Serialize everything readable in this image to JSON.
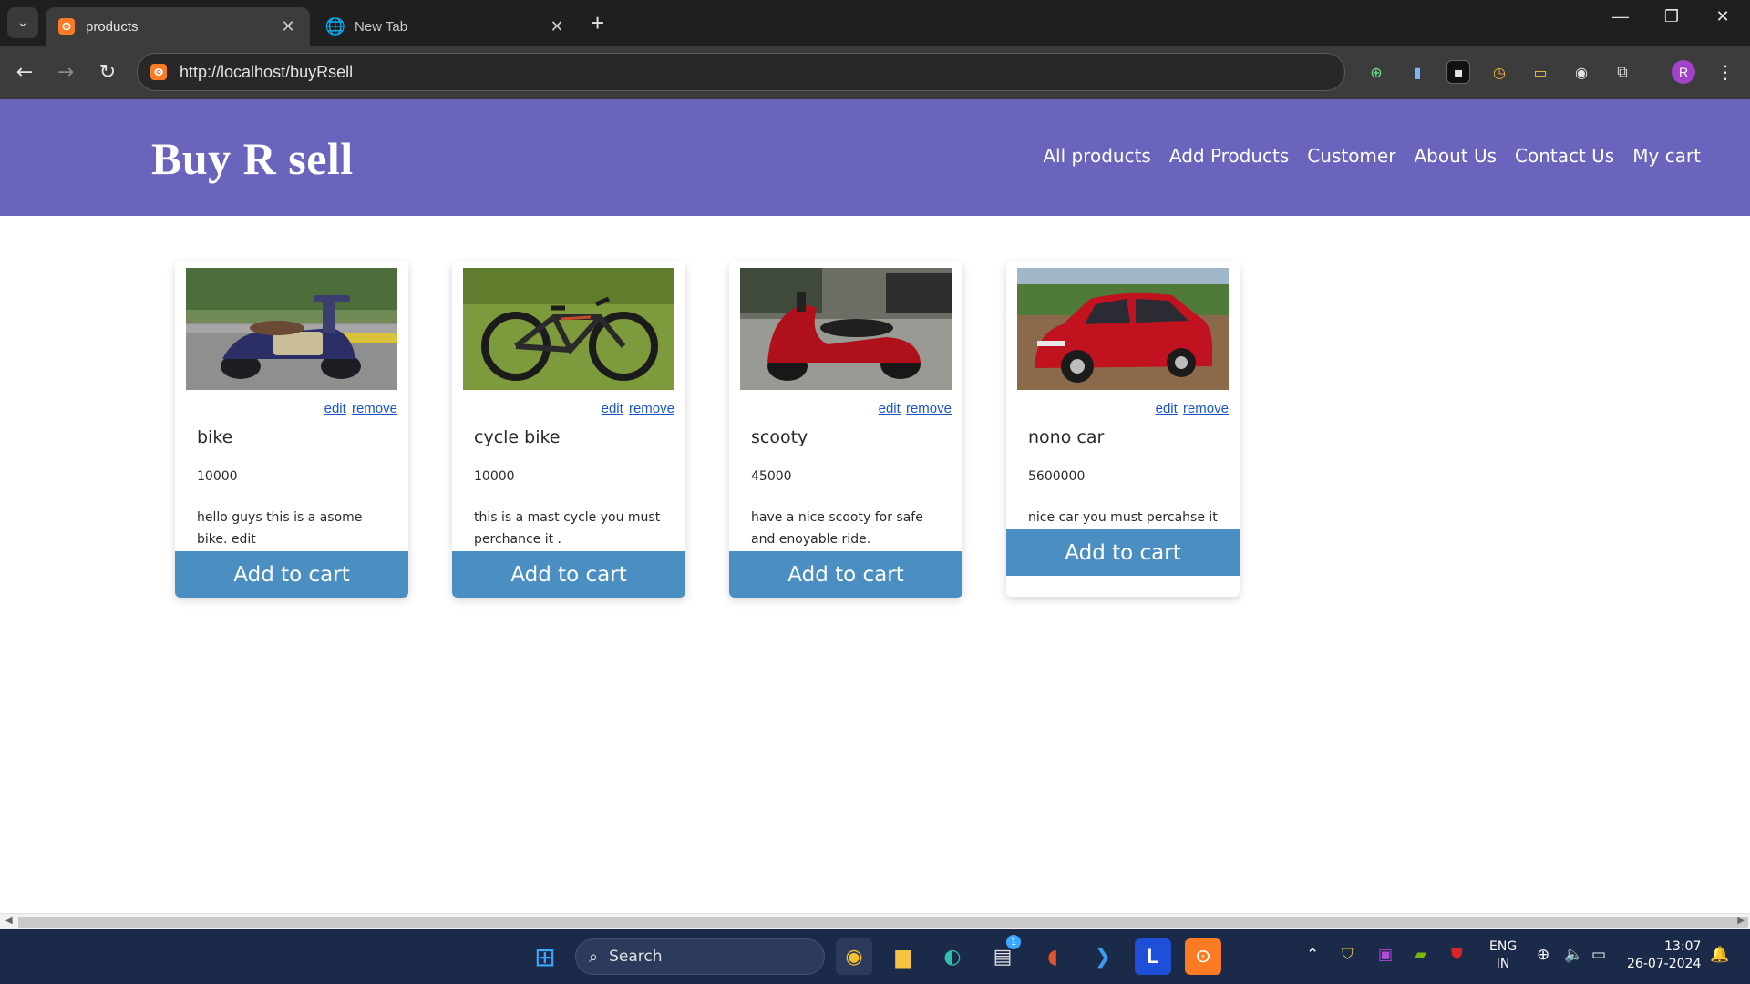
{
  "browser": {
    "tabs": [
      {
        "title": "products",
        "active": true
      },
      {
        "title": "New Tab",
        "active": false
      }
    ],
    "url": "http://localhost/buyRsell",
    "profile_initial": "R"
  },
  "site": {
    "brand": "Buy R sell",
    "nav": [
      "All products",
      "Add Products",
      "Customer",
      "About Us",
      "Contact Us",
      "My cart"
    ]
  },
  "products": [
    {
      "name": "bike",
      "price": "10000",
      "description": "hello guys this is a asome bike. edit",
      "edit_label": "edit",
      "remove_label": "remove",
      "cta": "Add to cart"
    },
    {
      "name": "cycle bike",
      "price": "10000",
      "description": "this is a mast cycle you must perchance it .",
      "edit_label": "edit",
      "remove_label": "remove",
      "cta": "Add to cart"
    },
    {
      "name": "scooty",
      "price": "45000",
      "description": "have a nice scooty for safe and enoyable ride.",
      "edit_label": "edit",
      "remove_label": "remove",
      "cta": "Add to cart"
    },
    {
      "name": "nono car",
      "price": "5600000",
      "description": "nice car you must percahse it",
      "edit_label": "edit",
      "remove_label": "remove",
      "cta": "Add to cart"
    }
  ],
  "taskbar": {
    "search_label": "Search",
    "language_line1": "ENG",
    "language_line2": "IN",
    "time": "13:07",
    "date": "26-07-2024",
    "store_badge": "1"
  },
  "colors": {
    "header": "#6a64bd",
    "button": "#4a8ec2",
    "link": "#1a55c8"
  }
}
